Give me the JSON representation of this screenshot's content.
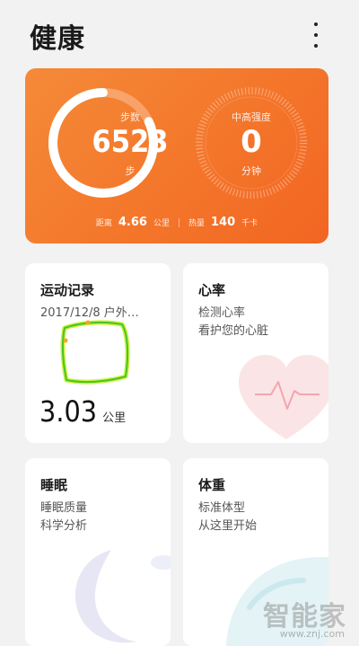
{
  "header": {
    "title": "健康"
  },
  "summary": {
    "steps": {
      "label": "步数",
      "value": "6523",
      "unit": "步",
      "progress": 0.82
    },
    "intensity": {
      "label": "中高强度",
      "value": "0",
      "unit": "分钟",
      "progress": 0
    },
    "distance": {
      "label": "距离",
      "value": "4.66",
      "unit": "公里"
    },
    "calories": {
      "label": "热量",
      "value": "140",
      "unit": "千卡"
    },
    "ring_color": "#ffffff",
    "background_color": "#f47a2d"
  },
  "cards": {
    "exercise": {
      "title": "运动记录",
      "subtitle": "2017/12/8 户外…",
      "distance": "3.03",
      "unit": "公里"
    },
    "heart_rate": {
      "title": "心率",
      "line1": "检测心率",
      "line2": "看护您的心脏"
    },
    "sleep": {
      "title": "睡眠",
      "line1": "睡眠质量",
      "line2": "科学分析"
    },
    "weight": {
      "title": "体重",
      "line1": "标准体型",
      "line2": "从这里开始"
    }
  },
  "watermark": {
    "text": "智能家",
    "url": "www.znj.com"
  }
}
